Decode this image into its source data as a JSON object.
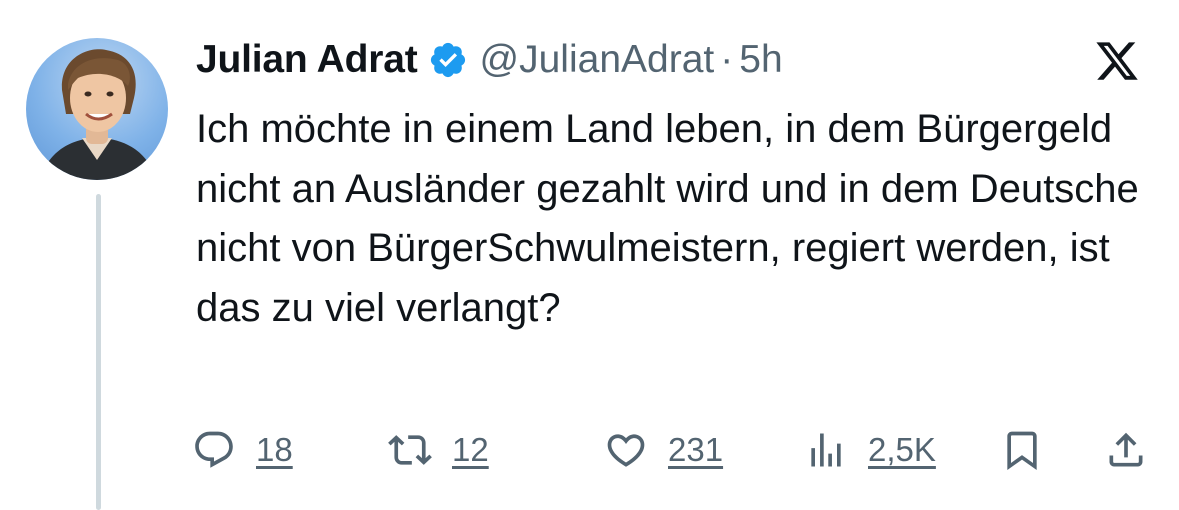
{
  "author": {
    "name": "Julian Adrat",
    "handle": "@JulianAdrat",
    "separator": "·",
    "time": "5h",
    "verified": true
  },
  "tweet": {
    "text": "Ich möchte in einem Land leben, in dem Bürgergeld nicht an Ausländer gezahlt wird und in dem Deutsche nicht von BürgerSchwulmeistern, regiert werden, ist das zu viel verlangt?"
  },
  "actions": {
    "reply_count": "18",
    "repost_count": "12",
    "like_count": "231",
    "views_count": "2,5K"
  },
  "icons": {
    "brand": "x-logo-icon",
    "verified": "verified-badge-icon",
    "reply": "reply-icon",
    "repost": "repost-icon",
    "like": "heart-icon",
    "views": "views-icon",
    "bookmark": "bookmark-icon",
    "share": "share-icon"
  },
  "colors": {
    "text": "#0f1419",
    "secondary": "#536471",
    "verified": "#1d9bf0",
    "thread_line": "#cfd9de"
  }
}
